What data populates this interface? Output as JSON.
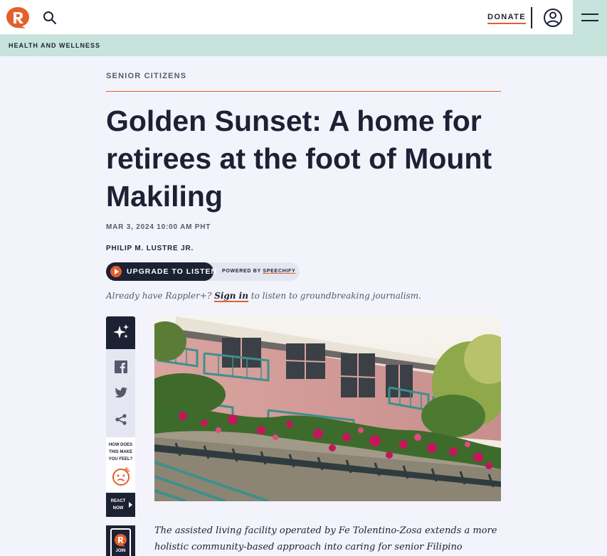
{
  "header": {
    "logo_icon": "rappler-logo-icon",
    "search_icon": "search-icon",
    "donate_label": "DONATE",
    "account_icon": "user-account-icon",
    "menu_icon": "hamburger-menu-icon"
  },
  "section": {
    "label": "HEALTH AND WELLNESS"
  },
  "article": {
    "kicker": "SENIOR CITIZENS",
    "headline": "Golden Sunset: A home for retirees at the foot of Mount Makiling",
    "date": "MAR 3, 2024 10:00 AM PHT",
    "author": "PHILIP M. LUSTRE JR.",
    "caption": "The assisted living facility operated by Fe Tolentino-Zosa extends a more holistic community-based approach into caring for senior Filipino retirees"
  },
  "listen": {
    "upgrade_label": "UPGRADE TO LISTEN",
    "powered_prefix": "POWERED BY ",
    "powered_brand": "SPEECHIFY",
    "already_prefix": "Already have Rappler+? ",
    "signin_label": "Sign in",
    "already_suffix": " to listen to groundbreaking journalism."
  },
  "share_rail": {
    "ai_icon": "sparkle-icon",
    "icons": [
      "facebook-icon",
      "twitter-icon",
      "share-icon"
    ],
    "feel_lines": [
      "HOW DOES",
      "THIS MAKE",
      "YOU FEEL?"
    ],
    "react_lines": [
      "REACT",
      "NOW"
    ],
    "join_label": "JOIN"
  },
  "colors": {
    "accent": "#e35f2d",
    "navy": "#1c2134",
    "mint": "#c6e3dc",
    "page_bg": "#f3f3fb"
  }
}
